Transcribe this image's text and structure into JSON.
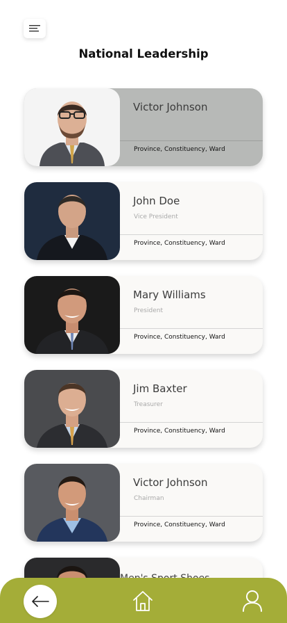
{
  "header": {
    "title": "National Leadership",
    "menu_icon": "menu-icon"
  },
  "leaders": [
    {
      "name": "Victor Johnson",
      "role": "",
      "location": "Province, Constituency, Ward",
      "selected": true
    },
    {
      "name": "John Doe",
      "role": "Vice President",
      "location": "Province, Constituency, Ward",
      "selected": false
    },
    {
      "name": "Mary Williams",
      "role": "President",
      "location": "Province, Constituency, Ward",
      "selected": false
    },
    {
      "name": "Jim Baxter",
      "role": "Treasurer",
      "location": "Province, Constituency, Ward",
      "selected": false
    },
    {
      "name": "Victor Johnson",
      "role": "Chairman",
      "location": "Province, Constituency, Ward",
      "selected": false
    }
  ],
  "partial_item": {
    "name": "Men's Sport Shoes"
  },
  "bottom_nav": {
    "back_icon": "arrow-left-icon",
    "home_icon": "home-icon",
    "user_icon": "user-icon"
  },
  "colors": {
    "accent": "#a4ad38",
    "selected_card": "#b7b9b7",
    "card": "#faf9f7"
  }
}
